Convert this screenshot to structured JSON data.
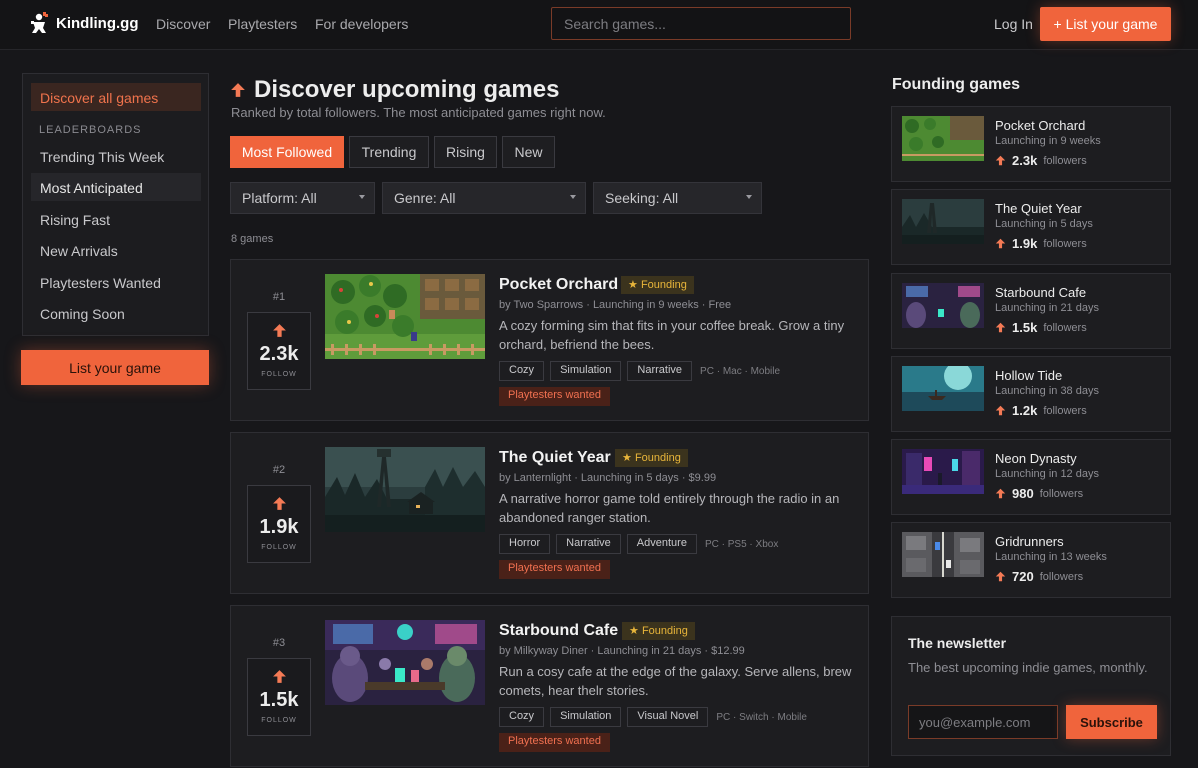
{
  "brand": {
    "name": "Kindling.gg",
    "icon": "kindling-logo-icon",
    "accent": "#f0643c"
  },
  "nav": {
    "links": [
      "Discover",
      "Playtesters",
      "For developers"
    ],
    "login": "Log In",
    "cta": "+ List your game"
  },
  "search": {
    "placeholder": "Search games..."
  },
  "sidebar": {
    "active": "Discover all games",
    "heading": "LEADERBOARDS",
    "items": [
      "Trending This Week",
      "Most Anticipated",
      "Rising Fast",
      "New Arrivals",
      "Playtesters Wanted",
      "Coming Soon"
    ],
    "selected_item": "Most Anticipated",
    "cta": "List your game"
  },
  "main": {
    "title": "Discover upcoming games",
    "subtitle": "Ranked by total followers. The most anticipated games right now.",
    "tabs": [
      "Most Followed",
      "Trending",
      "Rising",
      "New"
    ],
    "active_tab": "Most Followed",
    "filters": [
      "Platform: All",
      "Genre: All",
      "Seeking: All"
    ],
    "count": "8 games",
    "games": [
      {
        "rank": "#1",
        "followers": "2.3k",
        "follow_label": "FOLLOW",
        "title": "Pocket Orchard",
        "badge": "Founding",
        "meta": "by Two Sparrows · Launching in 9 weeks · Free",
        "desc": "A cozy forming sim that fits in your coffee break. Grow a tiny orchard, befriend the bees.",
        "tags": [
          "Cozy",
          "Simulation",
          "Narrative"
        ],
        "platforms": "PC · Mac · Mobile",
        "playtesters": "Playtesters wanted"
      },
      {
        "rank": "#2",
        "followers": "1.9k",
        "follow_label": "FOLLOW",
        "title": "The Quiet Year",
        "badge": "Founding",
        "meta": "by Lanternlight · Launching in 5 days · $9.99",
        "desc": "A narrative horror game told entirely through the radio in an abandoned ranger station.",
        "tags": [
          "Horror",
          "Narrative",
          "Adventure"
        ],
        "platforms": "PC · PS5 · Xbox",
        "playtesters": "Playtesters wanted"
      },
      {
        "rank": "#3",
        "followers": "1.5k",
        "follow_label": "FOLLOW",
        "title": "Starbound Cafe",
        "badge": "Founding",
        "meta": "by Milkyway Diner · Launching in 21 days · $12.99",
        "desc": "Run a cosy cafe at the edge of the galaxy. Serve allens, brew comets, hear thelr stories.",
        "tags": [
          "Cozy",
          "Simulation",
          "Visual Novel"
        ],
        "platforms": "PC · Switch · Mobile",
        "playtesters": "Playtesters wanted"
      }
    ]
  },
  "founding": {
    "title": "Founding games",
    "followers_label": "followers",
    "items": [
      {
        "title": "Pocket Orchard",
        "meta": "Launching in 9 weeks",
        "followers": "2.3k"
      },
      {
        "title": "The Quiet Year",
        "meta": "Launching in 5 days",
        "followers": "1.9k"
      },
      {
        "title": "Starbound Cafe",
        "meta": "Launching in 21 days",
        "followers": "1.5k"
      },
      {
        "title": "Hollow Tide",
        "meta": "Launching in 38 days",
        "followers": "1.2k"
      },
      {
        "title": "Neon Dynasty",
        "meta": "Launching in 12 days",
        "followers": "980"
      },
      {
        "title": "Gridrunners",
        "meta": "Launching in 13 weeks",
        "followers": "720"
      }
    ]
  },
  "newsletter": {
    "title": "The newsletter",
    "text": "The best upcoming indie games, monthly.",
    "placeholder": "you@example.com",
    "button": "Subscribe"
  }
}
